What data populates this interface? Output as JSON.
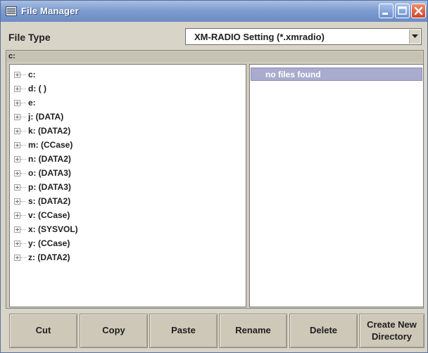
{
  "window": {
    "title": "File Manager",
    "icon": "file-manager-icon",
    "controls": [
      "minimize-icon",
      "maximize-icon",
      "close-icon"
    ]
  },
  "file_type": {
    "label": "File Type",
    "value": "XM-RADIO Setting (*.xmradio)"
  },
  "path": "c:",
  "tree": {
    "items": [
      {
        "label": "c:"
      },
      {
        "label": "d: ( )"
      },
      {
        "label": "e:"
      },
      {
        "label": "j: (DATA)"
      },
      {
        "label": "k: (DATA2)"
      },
      {
        "label": "m: (CCase)"
      },
      {
        "label": "n: (DATA2)"
      },
      {
        "label": "o: (DATA3)"
      },
      {
        "label": "p: (DATA3)"
      },
      {
        "label": "s: (DATA2)"
      },
      {
        "label": "v: (CCase)"
      },
      {
        "label": "x: (SYSVOL)"
      },
      {
        "label": "y: (CCase)"
      },
      {
        "label": "z: (DATA2)"
      }
    ]
  },
  "files": {
    "message": "no files found"
  },
  "buttons": {
    "cut": "Cut",
    "copy": "Copy",
    "paste": "Paste",
    "rename": "Rename",
    "delete": "Delete",
    "create_new_line1": "Create New",
    "create_new_line2": "Directory"
  },
  "colors": {
    "titlebar": "#7f9dcf",
    "window_bg": "#d8d4c8",
    "selection": "#a9acce",
    "close_button": "#d2452a"
  }
}
